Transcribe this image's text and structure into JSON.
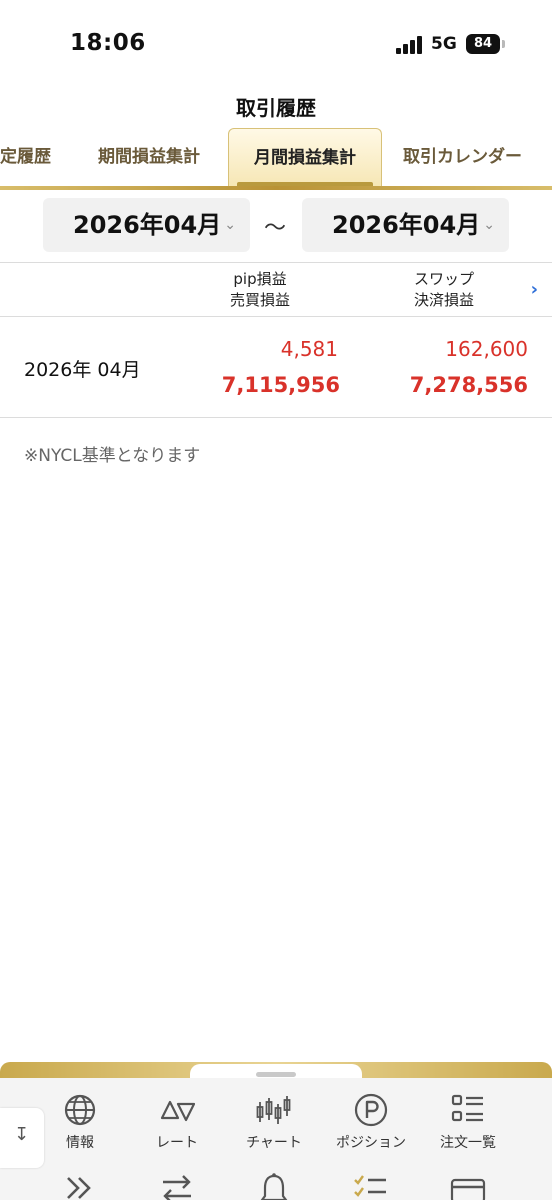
{
  "status_bar": {
    "time": "18:06",
    "network": "5G",
    "battery": "84"
  },
  "header": {
    "title": "取引履歴"
  },
  "tabs": [
    {
      "label": "定履歴"
    },
    {
      "label": "期間損益集計"
    },
    {
      "label": "月間損益集計",
      "active": true
    },
    {
      "label": "取引カレンダー"
    }
  ],
  "date_range": {
    "from": "2026年04月",
    "separator": "〜",
    "to": "2026年04月"
  },
  "table": {
    "col1": {
      "line1": "pip損益",
      "line2": "売買損益"
    },
    "col2": {
      "line1": "スワップ",
      "line2": "決済損益"
    },
    "rows": [
      {
        "period": "2026年 04月",
        "pip": "4,581",
        "trade": "7,115,956",
        "swap": "162,600",
        "settle": "7,278,556"
      }
    ]
  },
  "note": "※NYCL基準となります",
  "bottom_nav": {
    "items": [
      {
        "label": "情報",
        "icon": "globe-icon"
      },
      {
        "label": "レート",
        "icon": "rate-arrows-icon"
      },
      {
        "label": "チャート",
        "icon": "candlestick-icon"
      },
      {
        "label": "ポジション",
        "icon": "position-p-icon"
      },
      {
        "label": "注文一覧",
        "icon": "order-list-icon"
      }
    ],
    "row2_icons": [
      "double-chevron-icon",
      "swap-arrows-icon",
      "bell-icon",
      "checklist-icon",
      "card-icon"
    ]
  },
  "colors": {
    "accent_gold": "#b99336",
    "loss_profit_red": "#d9322a",
    "link_blue": "#2f6fd8"
  }
}
